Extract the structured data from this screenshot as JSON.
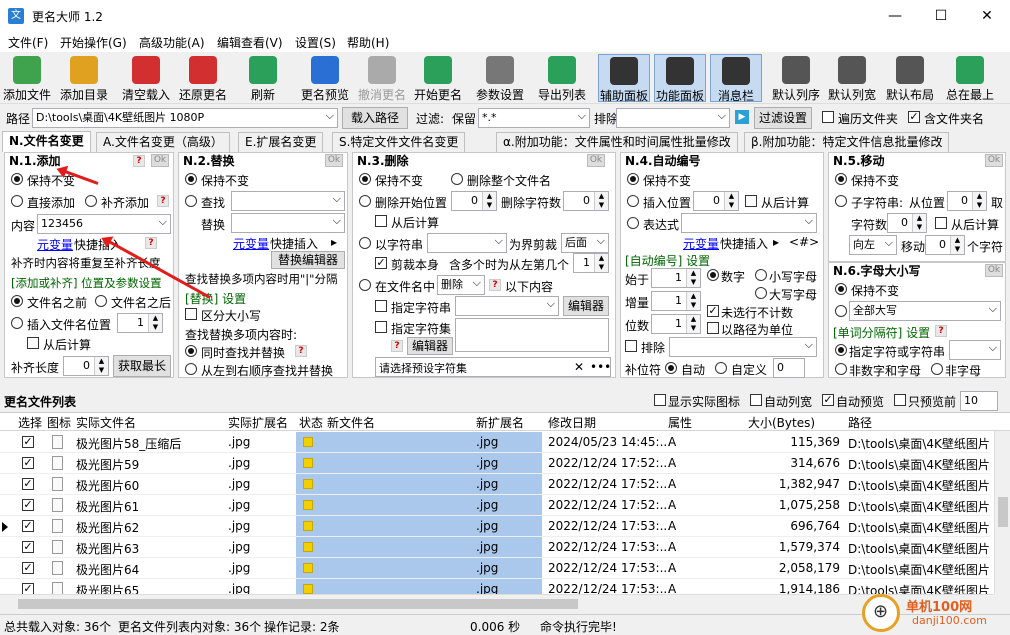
{
  "window": {
    "title": "更名大师 1.2",
    "min": "—",
    "max": "☐",
    "close": "✕",
    "app_icon": "文"
  },
  "menu": [
    "文件(F)",
    "开始操作(G)",
    "高级功能(A)",
    "编辑查看(V)",
    "设置(S)",
    "帮助(H)"
  ],
  "toolbar": [
    {
      "label": "添加文件",
      "icon": "add-file-icon",
      "color": "#3fa34d"
    },
    {
      "label": "添加目录",
      "icon": "add-folder-icon",
      "color": "#e0a020"
    },
    {
      "label": "清空载入",
      "icon": "clear-icon",
      "color": "#d23030"
    },
    {
      "label": "还原更名",
      "icon": "restore-icon",
      "color": "#d23030"
    },
    {
      "label": "刷新",
      "icon": "refresh-icon",
      "color": "#2aa05a"
    },
    {
      "label": "更名预览",
      "icon": "preview-icon",
      "color": "#2a6fd4"
    },
    {
      "label": "撤消更名",
      "icon": "undo-icon",
      "color": "#aaaaaa"
    },
    {
      "label": "开始更名",
      "icon": "start-icon",
      "color": "#2aa05a"
    },
    {
      "label": "参数设置",
      "icon": "tools-icon",
      "color": "#777777"
    },
    {
      "label": "导出列表",
      "icon": "export-icon",
      "color": "#2aa05a"
    },
    {
      "label": "辅助面板",
      "icon": "aux-panel-icon",
      "color": "#333333"
    },
    {
      "label": "功能面板",
      "icon": "func-panel-icon",
      "color": "#333333"
    },
    {
      "label": "消息栏",
      "icon": "message-bar-icon",
      "color": "#333333"
    },
    {
      "label": "默认列序",
      "icon": "col-order-icon",
      "color": "#555555"
    },
    {
      "label": "默认列宽",
      "icon": "col-width-icon",
      "color": "#555555"
    },
    {
      "label": "默认布局",
      "icon": "layout-icon",
      "color": "#555555"
    },
    {
      "label": "总在最上",
      "icon": "pin-icon",
      "color": "#2aa05a"
    }
  ],
  "pathbar": {
    "path_label": "路径",
    "path_value": "D:\\tools\\桌面\\4K壁纸图片 1080P",
    "load_btn": "载入路径",
    "filter_label": "过滤:",
    "keep_label": "保留",
    "keep_value": "*.*",
    "exclude_label": "排除",
    "filter_settings": "过滤设置",
    "traverse": "遍历文件夹",
    "include_folder": "含文件夹名"
  },
  "tabs": [
    "N.文件名变更",
    "A.文件名变更（高级）",
    "E.扩展名变更",
    "S.特定文件文件名变更",
    "α.附加功能：文件属性和时间属性批量修改",
    "β.附加功能：特定文件信息批量修改"
  ],
  "p1": {
    "title": "N.1.添加",
    "ok": "Ok",
    "q": "?",
    "keep": "保持不变",
    "direct": "直接添加",
    "pad": "补齐添加",
    "content_label": "内容",
    "content_value": "123456",
    "var_link": "元变量",
    "quick_insert": "快捷插入",
    "repeat_note": "补齐时内容将重复至补齐长度",
    "group": "[添加或补齐] 位置及参数设置",
    "before": "文件名之前",
    "after": "文件名之后",
    "insert_pos": "插入文件名位置",
    "insert_val": "1",
    "calc_back": "从后计算",
    "pad_len_label": "补齐长度",
    "pad_len_val": "0",
    "get_max": "获取最长"
  },
  "p2": {
    "title": "N.2.替换",
    "keep": "保持不变",
    "find": "查找",
    "replace": "替换",
    "var_link": "元变量",
    "quick_insert": "快捷插入",
    "quick_arrow": "▸",
    "editor": "替换编辑器",
    "multi_note": "查找替换多项内容时用\"|\"分隔",
    "group": "[替换] 设置",
    "case": "区分大小写",
    "multi_label": "查找替换多项内容时:",
    "simul": "同时查找并替换",
    "seq": "从左到右顺序查找并替换"
  },
  "p3": {
    "title": "N.3.删除",
    "keep": "保持不变",
    "del_all": "删除整个文件名",
    "del_start": "删除开始位置",
    "del_start_val": "0",
    "del_count": "删除字符数",
    "del_count_val": "0",
    "from_back": "从后计算",
    "by_str": "以字符串",
    "as_bound": "为界剪裁",
    "after": "后面",
    "trim_self": "剪裁本身",
    "multi_left": "含多个时为从左第几个",
    "multi_val": "1",
    "in_name": "在文件名中",
    "delete": "删除",
    "below": "以下内容",
    "spec_str": "指定字符串",
    "editor": "编辑器",
    "spec_set": "指定字符集",
    "editor2": "编辑器",
    "preset_placeholder": "请选择预设字符集",
    "clear_x": "✕",
    "dots": "•••"
  },
  "p4": {
    "title": "N.4.自动编号",
    "keep": "保持不变",
    "insert_pos": "插入位置",
    "insert_val": "0",
    "from_back": "从后计算",
    "expr": "表达式",
    "var_link": "元变量",
    "quick_insert": "快捷插入",
    "quick_arrow": "▸",
    "tag": "<#>",
    "group": "[自动编号] 设置",
    "start_label": "始于",
    "start_val": "1",
    "digit": "数字",
    "lower": "小写字母",
    "step_label": "增量",
    "step_val": "1",
    "upper": "大写字母",
    "width_label": "位数",
    "width_val": "1",
    "unselected": "未选行不计数",
    "path_unit": "以路径为单位",
    "exclude": "排除",
    "pad_label": "补位符",
    "auto": "自动",
    "custom": "自定义",
    "custom_val": "0"
  },
  "p5": {
    "title": "N.5.移动",
    "keep": "保持不变",
    "substr": "子字符串:",
    "from_pos": "从位置",
    "from_val": "0",
    "take": "取",
    "char_count": "字符数",
    "char_val": "0",
    "from_back": "从后计算",
    "dir": "向左",
    "move": "移动",
    "move_val": "0",
    "unit": "个字符"
  },
  "p6": {
    "title": "N.6.字母大小写",
    "keep": "保持不变",
    "all_upper": "全部大写",
    "group": "[单词分隔符] 设置",
    "spec_char": "指定字符或字符串",
    "non_num": "非数字和字母",
    "non_char": "非字母"
  },
  "list_header": {
    "title": "更名文件列表",
    "show_icon": "显示实际图标",
    "auto_width": "自动列宽",
    "auto_preview": "自动预览",
    "only_preview": "只预览前",
    "preview_n": "10"
  },
  "columns": [
    "选择",
    "图标",
    "实际文件名",
    "实际扩展名",
    "状态",
    "新文件名",
    "新扩展名",
    "修改日期",
    "属性",
    "大小(Bytes)",
    "路径"
  ],
  "rows": [
    {
      "name": "极光图片58_压缩后",
      "ext": ".jpg",
      "newext": ".jpg",
      "date": "2024/05/23 14:45:...",
      "attr": "A",
      "size": "115,369",
      "path": "D:\\tools\\桌面\\4K壁纸图片"
    },
    {
      "name": "极光图片59",
      "ext": ".jpg",
      "newext": ".jpg",
      "date": "2022/12/24 17:52:...",
      "attr": "A",
      "size": "314,676",
      "path": "D:\\tools\\桌面\\4K壁纸图片"
    },
    {
      "name": "极光图片60",
      "ext": ".jpg",
      "newext": ".jpg",
      "date": "2022/12/24 17:52:...",
      "attr": "A",
      "size": "1,382,947",
      "path": "D:\\tools\\桌面\\4K壁纸图片"
    },
    {
      "name": "极光图片61",
      "ext": ".jpg",
      "newext": ".jpg",
      "date": "2022/12/24 17:52:...",
      "attr": "A",
      "size": "1,075,258",
      "path": "D:\\tools\\桌面\\4K壁纸图片"
    },
    {
      "name": "极光图片62",
      "ext": ".jpg",
      "newext": ".jpg",
      "date": "2022/12/24 17:53:...",
      "attr": "A",
      "size": "696,764",
      "path": "D:\\tools\\桌面\\4K壁纸图片"
    },
    {
      "name": "极光图片63",
      "ext": ".jpg",
      "newext": ".jpg",
      "date": "2022/12/24 17:53:...",
      "attr": "A",
      "size": "1,579,374",
      "path": "D:\\tools\\桌面\\4K壁纸图片"
    },
    {
      "name": "极光图片64",
      "ext": ".jpg",
      "newext": ".jpg",
      "date": "2022/12/24 17:53:...",
      "attr": "A",
      "size": "2,058,179",
      "path": "D:\\tools\\桌面\\4K壁纸图片"
    },
    {
      "name": "极光图片65",
      "ext": ".jpg",
      "newext": ".jpg",
      "date": "2022/12/24 17:53:...",
      "attr": "A",
      "size": "1,914,186",
      "path": "D:\\tools\\桌面\\4K壁纸图片"
    }
  ],
  "status": {
    "total": "总共载入对象: 36个",
    "in_list": "更名文件列表内对象: 36个",
    "log": "操作记录: 2条",
    "time": "0.006 秒",
    "msg": "命令执行完毕!"
  },
  "watermark": {
    "line1": "单机100网",
    "line2": "danji100.com"
  }
}
